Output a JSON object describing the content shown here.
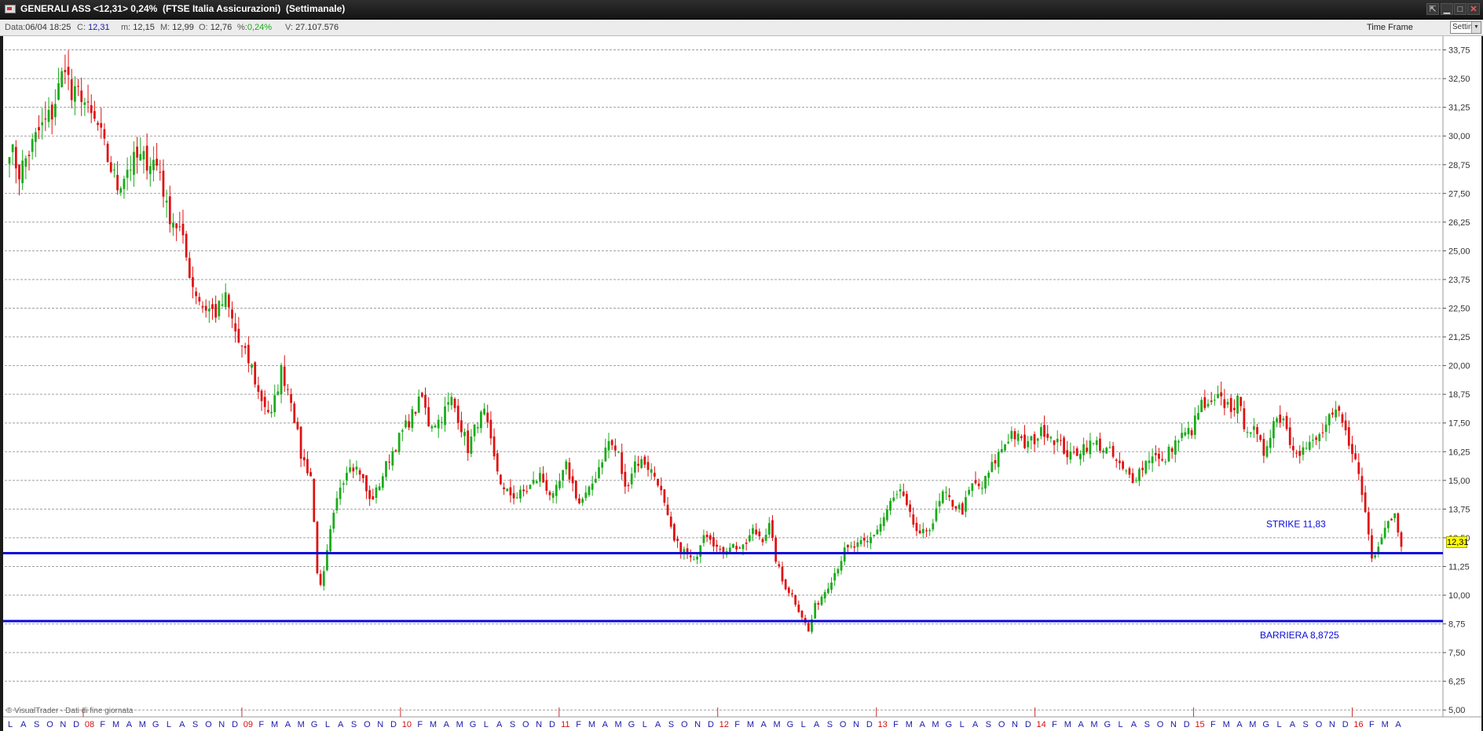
{
  "window": {
    "title": "GENERALI ASS <12,31> 0,24%  (FTSE Italia Assicurazioni)  (Settimanale)",
    "buttons": {
      "tools": "⇱",
      "minimize": "▁",
      "maximize": "□",
      "close": "✕"
    },
    "icons": {
      "app": "chart-window-icon"
    }
  },
  "infobar": {
    "date_label": "Data:",
    "date": "06/04 18:25",
    "close_label": "C:",
    "close": "12,31",
    "min_label": "m:",
    "min": "12,15",
    "max_label": "M:",
    "max": "12,99",
    "open_label": "O:",
    "open": "12,76",
    "pct_label": "%:",
    "pct": "0,24%",
    "vol_label": "V:",
    "vol": "27.107.576",
    "timeframe_label": "Time Frame",
    "timeframe_value": "Settimanale"
  },
  "colors": {
    "up": "#1aab1a",
    "down": "#e01010",
    "level": "#0a0ad6",
    "grid": "#a0a0a0",
    "month": "#1a1aa8",
    "year": "#d01010",
    "badge": "#fffb00"
  },
  "chart_data": {
    "type": "candlestick",
    "title": "GENERALI ASS (Settimanale)",
    "ylim": [
      4.7,
      34.35
    ],
    "y_ticks": [
      "5,00",
      "6,25",
      "7,50",
      "8,75",
      "10,00",
      "11,25",
      "12,50",
      "13,75",
      "15,00",
      "16,25",
      "17,50",
      "18,75",
      "20,00",
      "21,25",
      "22,50",
      "23,75",
      "25,00",
      "26,25",
      "27,50",
      "28,75",
      "30,00",
      "31,25",
      "32,50",
      "33,75"
    ],
    "grid": true,
    "x_ticks": [
      {
        "label": "L",
        "year": false
      },
      {
        "label": "A",
        "year": false
      },
      {
        "label": "S",
        "year": false
      },
      {
        "label": "O",
        "year": false
      },
      {
        "label": "N",
        "year": false
      },
      {
        "label": "D",
        "year": false
      },
      {
        "label": "08",
        "year": true
      },
      {
        "label": "F",
        "year": false
      },
      {
        "label": "M",
        "year": false
      },
      {
        "label": "A",
        "year": false
      },
      {
        "label": "M",
        "year": false
      },
      {
        "label": "G",
        "year": false
      },
      {
        "label": "L",
        "year": false
      },
      {
        "label": "A",
        "year": false
      },
      {
        "label": "S",
        "year": false
      },
      {
        "label": "O",
        "year": false
      },
      {
        "label": "N",
        "year": false
      },
      {
        "label": "D",
        "year": false
      },
      {
        "label": "09",
        "year": true
      },
      {
        "label": "F",
        "year": false
      },
      {
        "label": "M",
        "year": false
      },
      {
        "label": "A",
        "year": false
      },
      {
        "label": "M",
        "year": false
      },
      {
        "label": "G",
        "year": false
      },
      {
        "label": "L",
        "year": false
      },
      {
        "label": "A",
        "year": false
      },
      {
        "label": "S",
        "year": false
      },
      {
        "label": "O",
        "year": false
      },
      {
        "label": "N",
        "year": false
      },
      {
        "label": "D",
        "year": false
      },
      {
        "label": "10",
        "year": true
      },
      {
        "label": "F",
        "year": false
      },
      {
        "label": "M",
        "year": false
      },
      {
        "label": "A",
        "year": false
      },
      {
        "label": "M",
        "year": false
      },
      {
        "label": "G",
        "year": false
      },
      {
        "label": "L",
        "year": false
      },
      {
        "label": "A",
        "year": false
      },
      {
        "label": "S",
        "year": false
      },
      {
        "label": "O",
        "year": false
      },
      {
        "label": "N",
        "year": false
      },
      {
        "label": "D",
        "year": false
      },
      {
        "label": "11",
        "year": true
      },
      {
        "label": "F",
        "year": false
      },
      {
        "label": "M",
        "year": false
      },
      {
        "label": "A",
        "year": false
      },
      {
        "label": "M",
        "year": false
      },
      {
        "label": "G",
        "year": false
      },
      {
        "label": "L",
        "year": false
      },
      {
        "label": "A",
        "year": false
      },
      {
        "label": "S",
        "year": false
      },
      {
        "label": "O",
        "year": false
      },
      {
        "label": "N",
        "year": false
      },
      {
        "label": "D",
        "year": false
      },
      {
        "label": "12",
        "year": true
      },
      {
        "label": "F",
        "year": false
      },
      {
        "label": "M",
        "year": false
      },
      {
        "label": "A",
        "year": false
      },
      {
        "label": "M",
        "year": false
      },
      {
        "label": "G",
        "year": false
      },
      {
        "label": "L",
        "year": false
      },
      {
        "label": "A",
        "year": false
      },
      {
        "label": "S",
        "year": false
      },
      {
        "label": "O",
        "year": false
      },
      {
        "label": "N",
        "year": false
      },
      {
        "label": "D",
        "year": false
      },
      {
        "label": "13",
        "year": true
      },
      {
        "label": "F",
        "year": false
      },
      {
        "label": "M",
        "year": false
      },
      {
        "label": "A",
        "year": false
      },
      {
        "label": "M",
        "year": false
      },
      {
        "label": "G",
        "year": false
      },
      {
        "label": "L",
        "year": false
      },
      {
        "label": "A",
        "year": false
      },
      {
        "label": "S",
        "year": false
      },
      {
        "label": "O",
        "year": false
      },
      {
        "label": "N",
        "year": false
      },
      {
        "label": "D",
        "year": false
      },
      {
        "label": "14",
        "year": true
      },
      {
        "label": "F",
        "year": false
      },
      {
        "label": "M",
        "year": false
      },
      {
        "label": "A",
        "year": false
      },
      {
        "label": "M",
        "year": false
      },
      {
        "label": "G",
        "year": false
      },
      {
        "label": "L",
        "year": false
      },
      {
        "label": "A",
        "year": false
      },
      {
        "label": "S",
        "year": false
      },
      {
        "label": "O",
        "year": false
      },
      {
        "label": "N",
        "year": false
      },
      {
        "label": "D",
        "year": false
      },
      {
        "label": "15",
        "year": true
      },
      {
        "label": "F",
        "year": false
      },
      {
        "label": "M",
        "year": false
      },
      {
        "label": "A",
        "year": false
      },
      {
        "label": "M",
        "year": false
      },
      {
        "label": "G",
        "year": false
      },
      {
        "label": "L",
        "year": false
      },
      {
        "label": "A",
        "year": false
      },
      {
        "label": "S",
        "year": false
      },
      {
        "label": "O",
        "year": false
      },
      {
        "label": "N",
        "year": false
      },
      {
        "label": "D",
        "year": false
      },
      {
        "label": "16",
        "year": true
      },
      {
        "label": "F",
        "year": false
      },
      {
        "label": "M",
        "year": false
      },
      {
        "label": "A",
        "year": false
      }
    ],
    "price_anchors": [
      [
        0,
        29.6
      ],
      [
        3,
        28.4
      ],
      [
        9,
        30.2
      ],
      [
        13,
        31.0
      ],
      [
        16,
        32.6
      ],
      [
        17,
        33.3
      ],
      [
        19,
        31.6
      ],
      [
        22,
        31.9
      ],
      [
        24,
        31.0
      ],
      [
        27,
        30.4
      ],
      [
        30,
        29.0
      ],
      [
        33,
        27.8
      ],
      [
        36,
        28.6
      ],
      [
        39,
        29.0
      ],
      [
        44,
        28.9
      ],
      [
        46,
        28.5
      ],
      [
        48,
        26.8
      ],
      [
        52,
        25.9
      ],
      [
        56,
        23.5
      ],
      [
        59,
        22.6
      ],
      [
        63,
        22.3
      ],
      [
        66,
        22.9
      ],
      [
        70,
        21.0
      ],
      [
        74,
        19.9
      ],
      [
        76,
        18.8
      ],
      [
        80,
        17.8
      ],
      [
        83,
        19.8
      ],
      [
        86,
        18.6
      ],
      [
        89,
        16.1
      ],
      [
        92,
        15.2
      ],
      [
        94,
        11.1
      ],
      [
        95,
        10.3
      ],
      [
        96,
        10.9
      ],
      [
        98,
        12.7
      ],
      [
        101,
        14.8
      ],
      [
        104,
        15.8
      ],
      [
        107,
        15.4
      ],
      [
        110,
        14.1
      ],
      [
        112,
        14.5
      ],
      [
        116,
        16.0
      ],
      [
        120,
        17.1
      ],
      [
        124,
        18.1
      ],
      [
        126,
        18.6
      ],
      [
        128,
        17.5
      ],
      [
        131,
        17.6
      ],
      [
        135,
        18.5
      ],
      [
        137,
        17.8
      ],
      [
        140,
        16.4
      ],
      [
        143,
        17.6
      ],
      [
        145,
        17.9
      ],
      [
        148,
        15.9
      ],
      [
        151,
        14.5
      ],
      [
        155,
        14.3
      ],
      [
        158,
        14.6
      ],
      [
        162,
        15.2
      ],
      [
        166,
        14.2
      ],
      [
        170,
        15.6
      ],
      [
        174,
        14.0
      ],
      [
        177,
        14.5
      ],
      [
        180,
        15.6
      ],
      [
        183,
        16.7
      ],
      [
        186,
        16.1
      ],
      [
        188,
        14.6
      ],
      [
        191,
        15.8
      ],
      [
        194,
        15.8
      ],
      [
        198,
        15.0
      ],
      [
        201,
        13.3
      ],
      [
        203,
        12.3
      ],
      [
        206,
        11.9
      ],
      [
        209,
        11.4
      ],
      [
        212,
        12.8
      ],
      [
        214,
        12.6
      ],
      [
        217,
        11.8
      ],
      [
        220,
        12.2
      ],
      [
        224,
        12.0
      ],
      [
        227,
        12.8
      ],
      [
        230,
        12.5
      ],
      [
        232,
        13.0
      ],
      [
        234,
        11.6
      ],
      [
        236,
        10.6
      ],
      [
        239,
        10.0
      ],
      [
        242,
        9.1
      ],
      [
        244,
        8.4
      ],
      [
        246,
        9.5
      ],
      [
        249,
        10.2
      ],
      [
        252,
        11.0
      ],
      [
        255,
        11.9
      ],
      [
        258,
        12.1
      ],
      [
        262,
        12.3
      ],
      [
        266,
        13.1
      ],
      [
        269,
        14.0
      ],
      [
        272,
        14.5
      ],
      [
        275,
        13.4
      ],
      [
        278,
        12.5
      ],
      [
        282,
        13.2
      ],
      [
        285,
        14.4
      ],
      [
        288,
        14.0
      ],
      [
        291,
        13.7
      ],
      [
        294,
        14.8
      ],
      [
        297,
        14.7
      ],
      [
        300,
        15.6
      ],
      [
        303,
        16.4
      ],
      [
        306,
        17.1
      ],
      [
        310,
        16.5
      ],
      [
        313,
        16.8
      ],
      [
        316,
        17.2
      ],
      [
        320,
        16.7
      ],
      [
        324,
        16.0
      ],
      [
        328,
        16.5
      ],
      [
        332,
        16.6
      ],
      [
        336,
        16.2
      ],
      [
        340,
        15.4
      ],
      [
        343,
        15.1
      ],
      [
        346,
        15.6
      ],
      [
        349,
        16.2
      ],
      [
        352,
        15.7
      ],
      [
        355,
        16.5
      ],
      [
        358,
        16.9
      ],
      [
        361,
        17.2
      ],
      [
        364,
        18.3
      ],
      [
        366,
        18.1
      ],
      [
        369,
        18.5
      ],
      [
        373,
        18.2
      ],
      [
        375,
        18.4
      ],
      [
        377,
        17.5
      ],
      [
        380,
        17.1
      ],
      [
        383,
        16.2
      ],
      [
        386,
        17.6
      ],
      [
        389,
        17.8
      ],
      [
        391,
        16.7
      ],
      [
        394,
        16.3
      ],
      [
        397,
        16.5
      ],
      [
        400,
        16.9
      ],
      [
        403,
        17.6
      ],
      [
        406,
        17.9
      ],
      [
        408,
        17.0
      ],
      [
        410,
        16.4
      ],
      [
        412,
        15.2
      ],
      [
        414,
        13.6
      ],
      [
        415,
        12.7
      ],
      [
        416,
        11.6
      ],
      [
        417,
        11.9
      ],
      [
        419,
        12.7
      ],
      [
        421,
        13.3
      ],
      [
        423,
        13.5
      ],
      [
        424,
        12.9
      ],
      [
        425,
        12.3
      ]
    ],
    "levels": [
      {
        "name": "STRIKE",
        "value": 11.83,
        "label": "STRIKE  11,83"
      },
      {
        "name": "BARRIERA",
        "value": 8.8725,
        "label": "BARRIERA  8,8725"
      }
    ],
    "last_price": {
      "value": 12.31,
      "label": "12,31"
    },
    "watermark": "© VisualTrader - Dati di fine giornata"
  }
}
